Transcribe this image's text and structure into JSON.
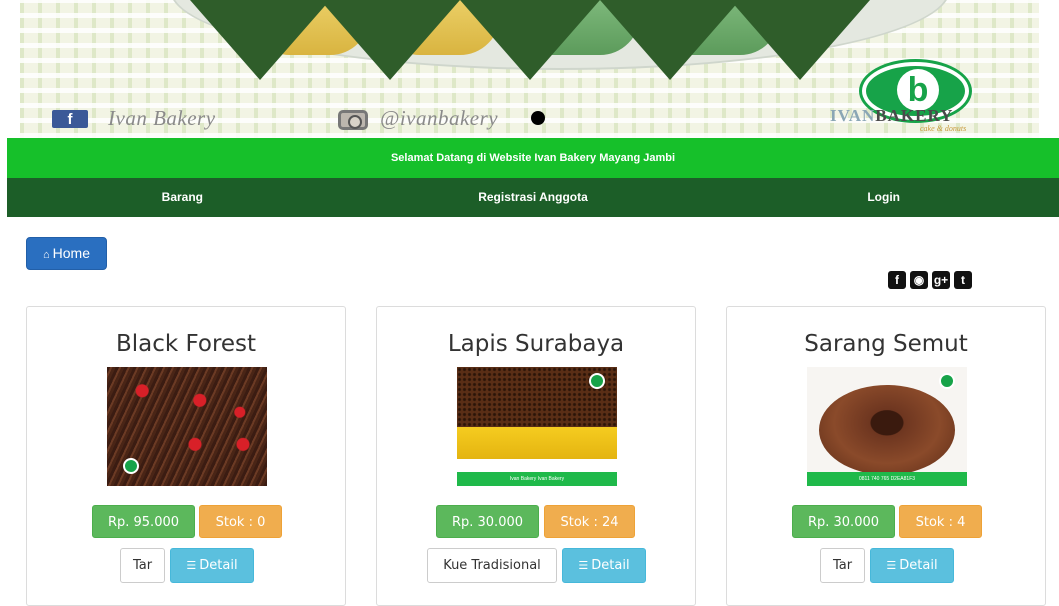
{
  "banner": {
    "facebook_icon": "f",
    "facebook_text": "Ivan Bakery",
    "instagram_text": "@ivanbakery",
    "logo_glyph": "b",
    "logo_text_a": "IVAN",
    "logo_text_b": "BAKERY",
    "logo_sub": "cake & donuts"
  },
  "welcome": {
    "text": "Selamat Datang di Website Ivan Bakery Mayang Jambi"
  },
  "nav": {
    "items": [
      {
        "label": "Barang"
      },
      {
        "label": "Registrasi Anggota"
      },
      {
        "label": "Login"
      }
    ]
  },
  "home": {
    "label": "Home",
    "icon": "home-icon"
  },
  "social": {
    "icons": [
      "facebook-icon",
      "instagram-icon",
      "google-plus-icon",
      "twitter-icon"
    ]
  },
  "products": [
    {
      "name": "Black Forest",
      "price": "Rp. 95.000",
      "stock": "Stok : 0",
      "category": "Tar",
      "detail": "Detail"
    },
    {
      "name": "Lapis Surabaya",
      "price": "Rp. 30.000",
      "stock": "Stok : 24",
      "category": "Kue Tradisional",
      "detail": "Detail",
      "image_caption": "Ivan Bakery   Ivan Bakery"
    },
    {
      "name": "Sarang Semut",
      "price": "Rp. 30.000",
      "stock": "Stok : 4",
      "category": "Tar",
      "detail": "Detail",
      "image_caption": "0811 740 765   D2EA81F3"
    }
  ],
  "colors": {
    "welcome_bar": "#16c02a",
    "nav_bar": "#1c5e28",
    "home_button": "#2a6fc0",
    "price_tag": "#5cb85c",
    "stock_tag": "#f0ad4e",
    "detail_button": "#5bc0de"
  }
}
